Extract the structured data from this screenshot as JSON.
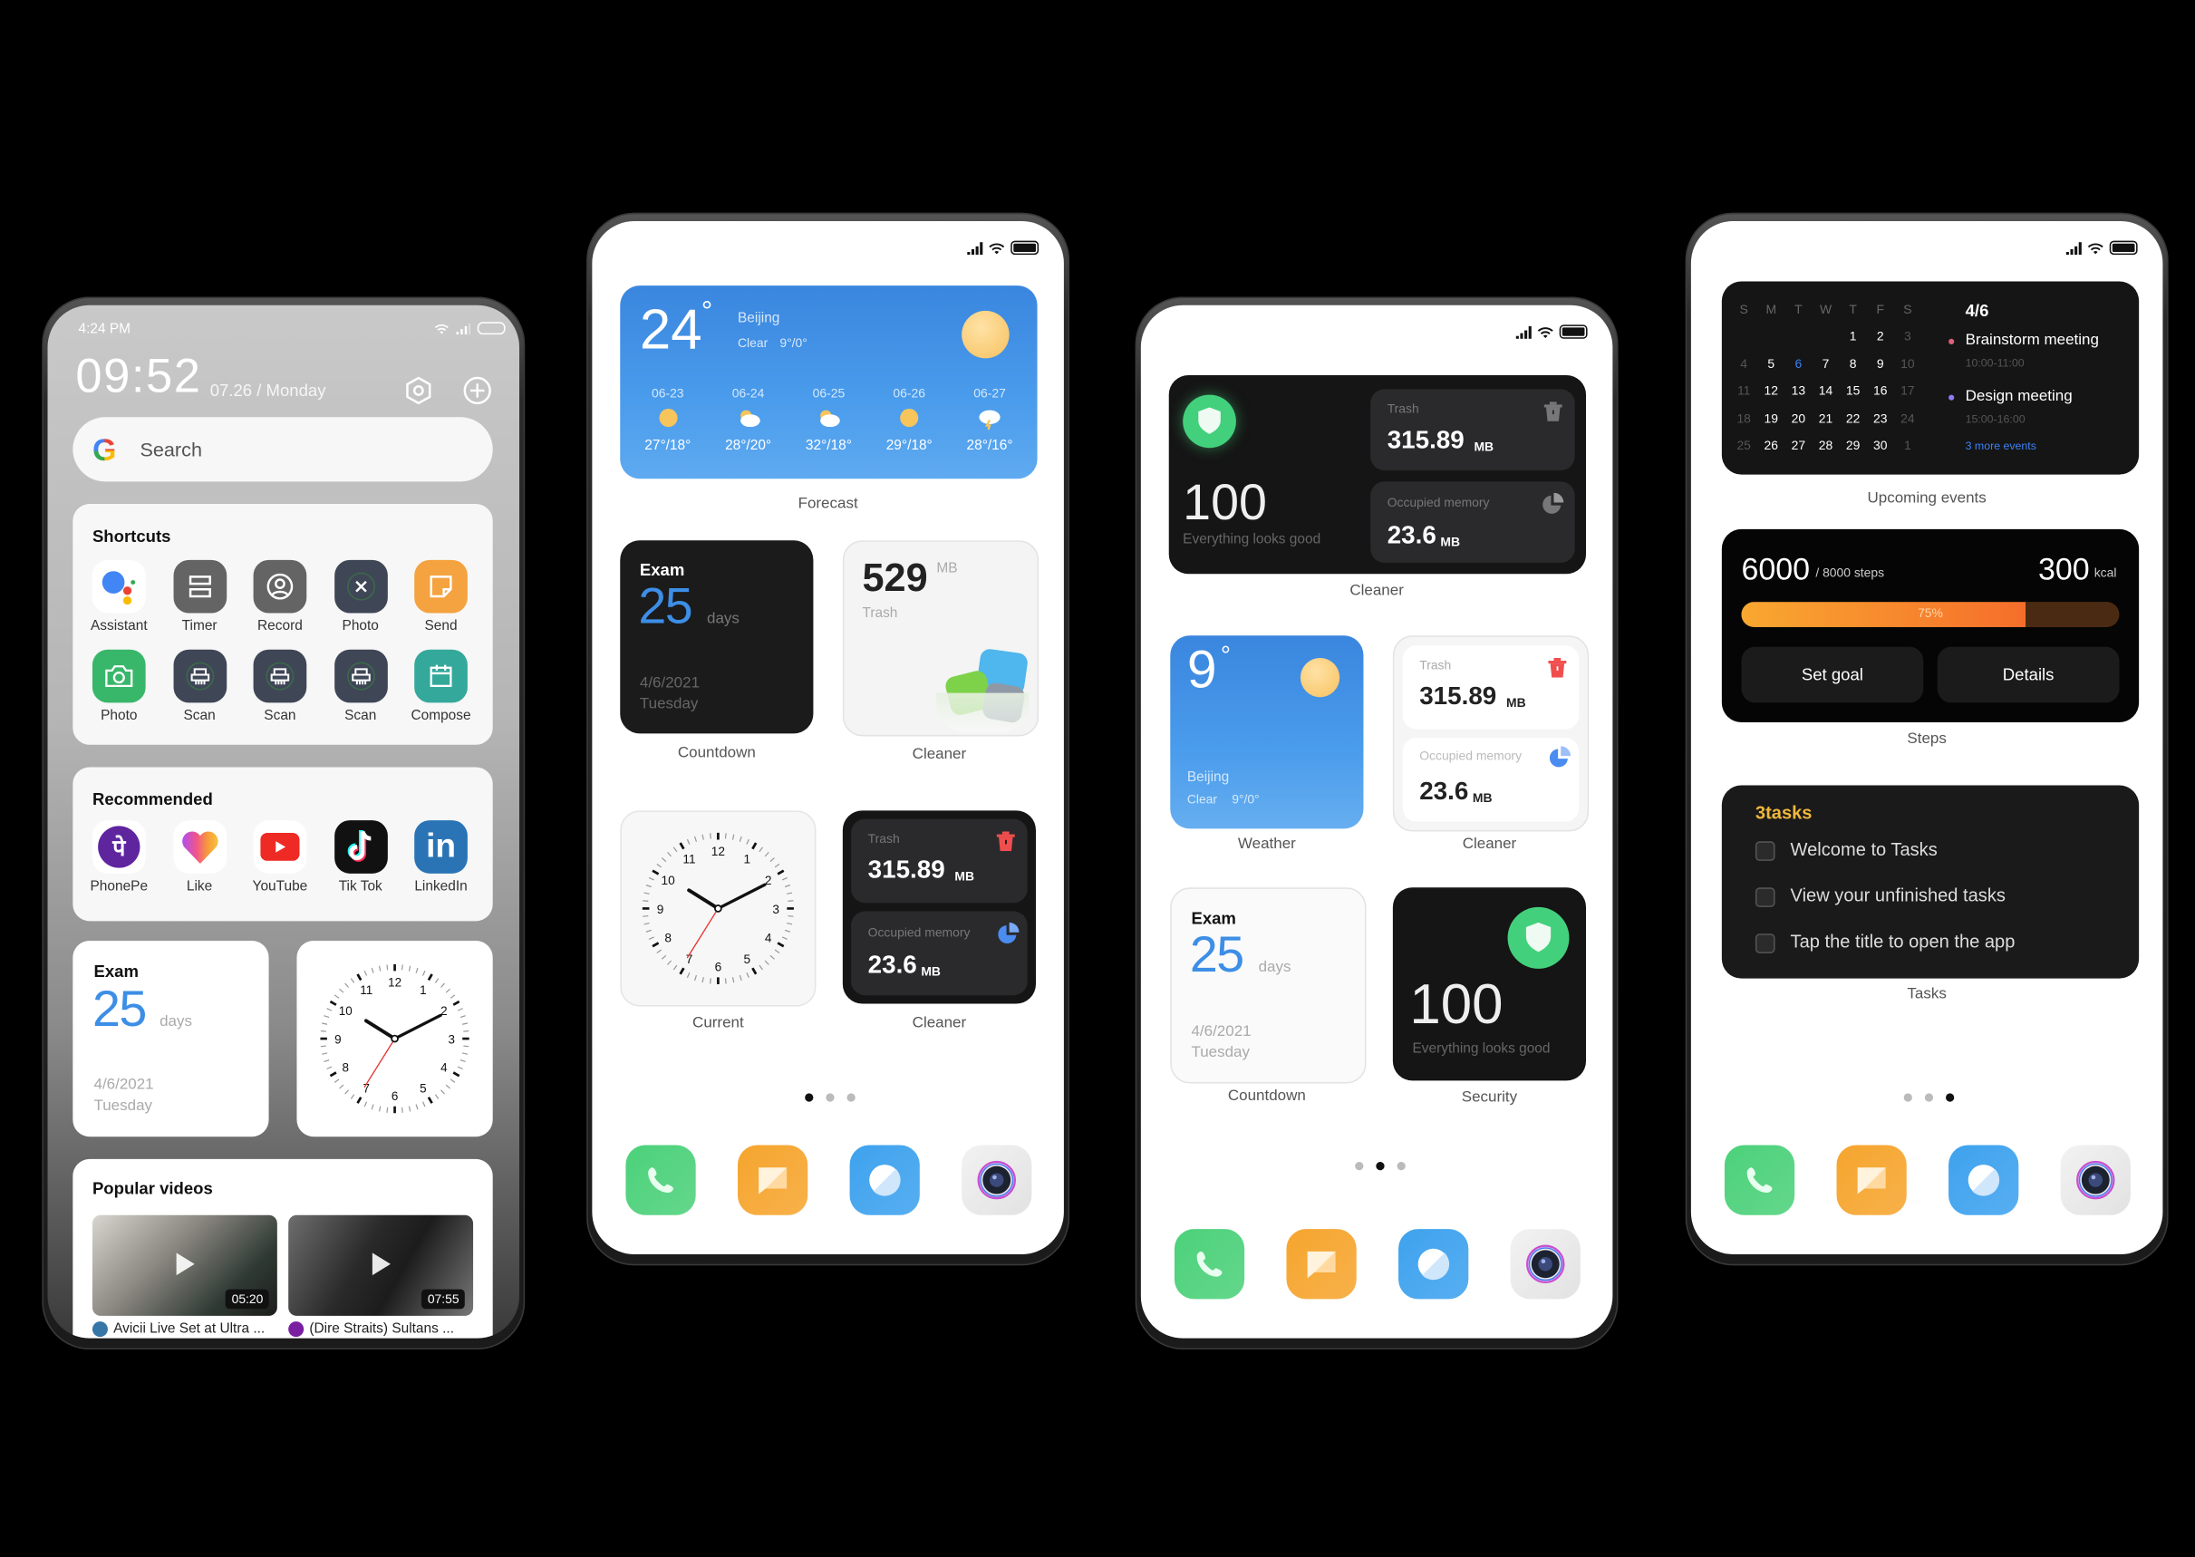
{
  "phones": {
    "p1": {
      "status_time": "4:24 PM",
      "clock": "09:52",
      "date": "07.26 / Monday",
      "search_placeholder": "Search",
      "shortcuts": {
        "title": "Shortcuts",
        "items": [
          {
            "label": "Assistant",
            "icon": "google-assistant-icon"
          },
          {
            "label": "Timer",
            "icon": "timer-icon"
          },
          {
            "label": "Record",
            "icon": "record-icon"
          },
          {
            "label": "Photo",
            "icon": "close-circle-icon"
          },
          {
            "label": "Send",
            "icon": "note-icon"
          },
          {
            "label": "Photo",
            "icon": "camera-icon"
          },
          {
            "label": "Scan",
            "icon": "scanner-icon"
          },
          {
            "label": "Scan",
            "icon": "scanner-icon"
          },
          {
            "label": "Scan",
            "icon": "scanner-icon"
          },
          {
            "label": "Compose",
            "icon": "calendar-icon"
          }
        ]
      },
      "recommended": {
        "title": "Recommended",
        "items": [
          {
            "label": "PhonePe",
            "icon": "phonepe-icon"
          },
          {
            "label": "Like",
            "icon": "like-heart-icon"
          },
          {
            "label": "YouTube",
            "icon": "youtube-icon"
          },
          {
            "label": "Tik Tok",
            "icon": "tiktok-icon"
          },
          {
            "label": "LinkedIn",
            "icon": "linkedin-icon"
          }
        ]
      },
      "countdown": {
        "title": "Exam",
        "value": "25",
        "unit": "days",
        "date": "4/6/2021",
        "weekday": "Tuesday"
      },
      "popular_videos": {
        "title": "Popular videos",
        "items": [
          {
            "duration": "05:20",
            "title": "Avicii Live Set at Ultra ..."
          },
          {
            "duration": "07:55",
            "title": "(Dire Straits) Sultans ..."
          }
        ]
      }
    },
    "p2": {
      "forecast": {
        "temp": "24",
        "deg": "°",
        "city": "Beijing",
        "condition": "Clear",
        "range": "9°/0°",
        "days": [
          {
            "date": "06-23",
            "icon": "sun-icon",
            "temp": "27°/18°"
          },
          {
            "date": "06-24",
            "icon": "partly-cloudy-icon",
            "temp": "28°/20°"
          },
          {
            "date": "06-25",
            "icon": "partly-cloudy-icon",
            "temp": "32°/18°"
          },
          {
            "date": "06-26",
            "icon": "sun-icon",
            "temp": "29°/18°"
          },
          {
            "date": "06-27",
            "icon": "thunderstorm-icon",
            "temp": "28°/16°"
          }
        ],
        "caption": "Forecast"
      },
      "countdown": {
        "title": "Exam",
        "value": "25",
        "unit": "days",
        "date": "4/6/2021",
        "weekday": "Tuesday",
        "caption": "Countdown"
      },
      "cleaner_trash": {
        "value": "529",
        "unit": "MB",
        "label": "Trash",
        "caption": "Cleaner"
      },
      "clock_caption": "Current",
      "cleaner_dark": {
        "trash_label": "Trash",
        "trash_value": "315.89",
        "trash_unit": "MB",
        "mem_label": "Occupied memory",
        "mem_value": "23.6",
        "mem_unit": "MB",
        "caption": "Cleaner"
      },
      "page_index": 1,
      "page_count": 3
    },
    "p3": {
      "cleaner_wide": {
        "score": "100",
        "status": "Everything looks good",
        "trash_label": "Trash",
        "trash_value": "315.89",
        "trash_unit": "MB",
        "mem_label": "Occupied memory",
        "mem_value": "23.6",
        "mem_unit": "MB",
        "caption": "Cleaner"
      },
      "weather": {
        "temp": "9",
        "deg": "°",
        "city": "Beijing",
        "condition": "Clear",
        "range": "9°/0°",
        "caption": "Weather"
      },
      "cleaner_light": {
        "trash_label": "Trash",
        "trash_value": "315.89",
        "trash_unit": "MB",
        "mem_label": "Occupied memory",
        "mem_value": "23.6",
        "mem_unit": "MB",
        "caption": "Cleaner"
      },
      "countdown": {
        "title": "Exam",
        "value": "25",
        "unit": "days",
        "date": "4/6/2021",
        "weekday": "Tuesday",
        "caption": "Countdown"
      },
      "security": {
        "score": "100",
        "status": "Everything looks good",
        "caption": "Security"
      },
      "page_index": 2,
      "page_count": 3
    },
    "p4": {
      "calendar": {
        "weekdays": [
          "S",
          "M",
          "T",
          "W",
          "T",
          "F",
          "S"
        ],
        "weeks": [
          [
            "",
            "",
            "",
            "",
            "1",
            "2",
            "3"
          ],
          [
            "4",
            "5",
            "6",
            "7",
            "8",
            "9",
            "10"
          ],
          [
            "11",
            "12",
            "13",
            "14",
            "15",
            "16",
            "17"
          ],
          [
            "18",
            "19",
            "20",
            "21",
            "22",
            "23",
            "24"
          ],
          [
            "25",
            "26",
            "27",
            "28",
            "29",
            "30",
            "1"
          ]
        ],
        "today": "6",
        "date": "4/6",
        "events": [
          {
            "title": "Brainstorm meeting",
            "time": "10:00-11:00",
            "color": "#e0607e"
          },
          {
            "title": "Design meeting",
            "time": "15:00-16:00",
            "color": "#8b7cf6"
          }
        ],
        "more": "3 more events",
        "caption": "Upcoming events"
      },
      "steps": {
        "steps": "6000",
        "goal": "/ 8000 steps",
        "kcal": "300",
        "kcal_unit": "kcal",
        "progress_percent": 75,
        "progress_label": "75%",
        "set_goal": "Set goal",
        "details": "Details",
        "caption": "Steps"
      },
      "tasks": {
        "title": "3tasks",
        "items": [
          "Welcome to Tasks",
          "View your unfinished tasks",
          "Tap the title to open the app"
        ],
        "caption": "Tasks"
      },
      "page_index": 3,
      "page_count": 3
    }
  },
  "dock": [
    {
      "name": "phone-app",
      "icon": "phone-icon",
      "color": "#4cd17a"
    },
    {
      "name": "notes-app",
      "icon": "notes-icon",
      "color": "#f6a52e"
    },
    {
      "name": "browser-app",
      "icon": "browser-icon",
      "color": "#3ea2ee"
    },
    {
      "name": "camera-app",
      "icon": "camera-icon",
      "color": "#eeeeee"
    }
  ],
  "colors": {
    "accent_blue": "#3d8ee6",
    "security_green": "#43d07c",
    "trash_red": "#f04e4e",
    "steps_orange": "#f7852b",
    "tasks_yellow": "#f0b73c"
  }
}
